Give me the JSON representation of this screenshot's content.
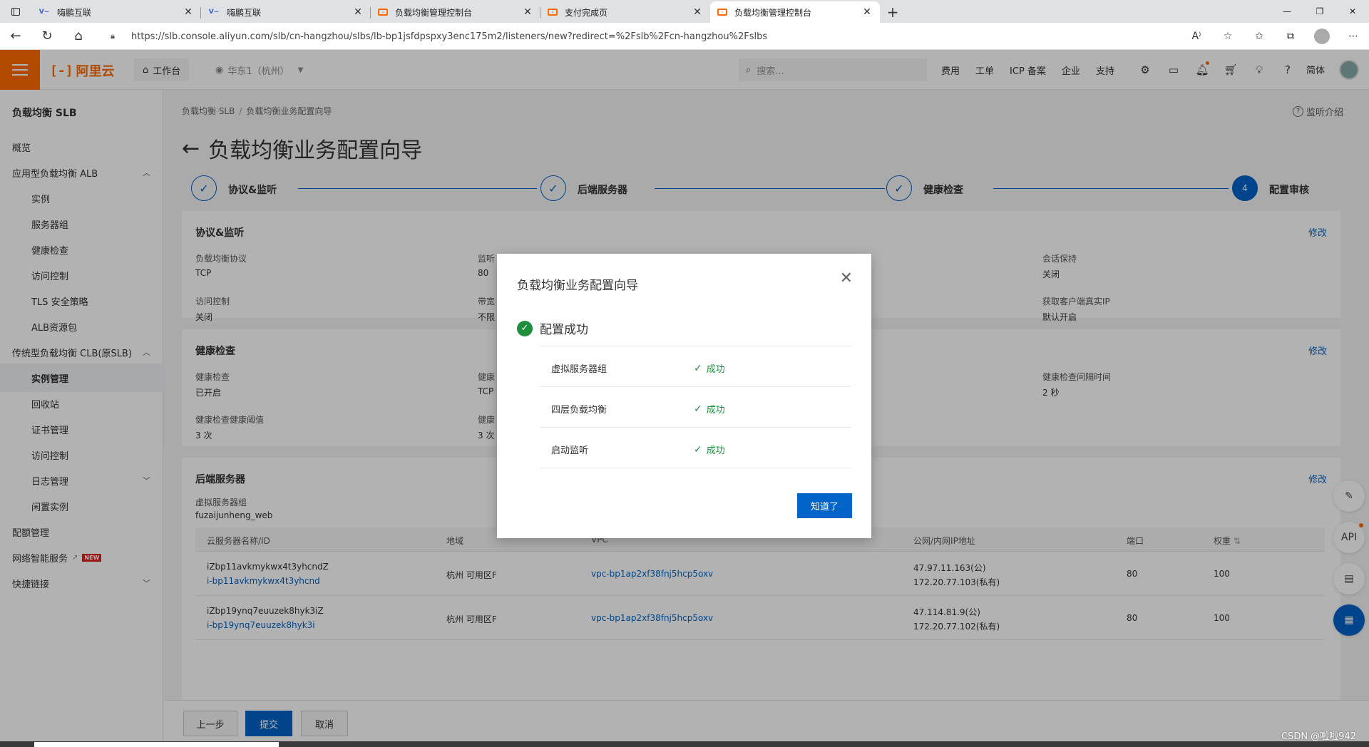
{
  "browser": {
    "tabs": [
      {
        "title": "嗨鹏互联",
        "favicon": "blue"
      },
      {
        "title": "嗨鹏互联",
        "favicon": "blue"
      },
      {
        "title": "负载均衡管理控制台",
        "favicon": "orange"
      },
      {
        "title": "支付完成页",
        "favicon": "orange"
      },
      {
        "title": "负载均衡管理控制台",
        "favicon": "orange",
        "active": true
      }
    ],
    "url": "https://slb.console.aliyun.com/slb/cn-hangzhou/slbs/lb-bp1jsfdpspxy3enc175m2/listeners/new?redirect=%2Fslb%2Fcn-hangzhou%2Fslbs",
    "read_aloud": "A⁾"
  },
  "console": {
    "logo_text": "阿里云",
    "workbench": "工作台",
    "region": "华东1（杭州）",
    "search_placeholder": "搜索...",
    "links": [
      "费用",
      "工单",
      "ICP 备案",
      "企业",
      "支持"
    ],
    "lang": "简体"
  },
  "sidebar": {
    "title": "负载均衡 SLB",
    "items": [
      {
        "label": "概览",
        "level": 1
      },
      {
        "label": "应用型负载均衡 ALB",
        "level": 1,
        "chev": "up"
      },
      {
        "label": "实例",
        "level": 2
      },
      {
        "label": "服务器组",
        "level": 2
      },
      {
        "label": "健康检查",
        "level": 2
      },
      {
        "label": "访问控制",
        "level": 2
      },
      {
        "label": "TLS 安全策略",
        "level": 2
      },
      {
        "label": "ALB资源包",
        "level": 2
      },
      {
        "label": "传统型负载均衡 CLB(原SLB)",
        "level": 1,
        "chev": "up"
      },
      {
        "label": "实例管理",
        "level": 2,
        "active": true
      },
      {
        "label": "回收站",
        "level": 2
      },
      {
        "label": "证书管理",
        "level": 2
      },
      {
        "label": "访问控制",
        "level": 2
      },
      {
        "label": "日志管理",
        "level": 2,
        "chev": "down"
      },
      {
        "label": "闲置实例",
        "level": 2
      },
      {
        "label": "配额管理",
        "level": 1
      },
      {
        "label": "网络智能服务",
        "level": 1,
        "new": "NEW"
      },
      {
        "label": "快捷链接",
        "level": 1,
        "chev": "down"
      }
    ]
  },
  "main": {
    "breadcrumb": [
      "负载均衡 SLB",
      "负载均衡业务配置向导"
    ],
    "help_link": "监听介绍",
    "title": "负载均衡业务配置向导",
    "steps": [
      {
        "label": "协议&监听",
        "state": "done"
      },
      {
        "label": "后端服务器",
        "state": "done"
      },
      {
        "label": "健康检查",
        "state": "done"
      },
      {
        "label": "配置审核",
        "state": "current",
        "number": "4"
      }
    ],
    "edit_label": "修改",
    "protocol_card": {
      "title": "协议&监听",
      "fields": [
        {
          "label": "负载均衡协议",
          "value": "TCP"
        },
        {
          "label": "监听",
          "value": "80"
        },
        {
          "label": "会话保持",
          "value": "关闭"
        },
        {
          "label": "访问控制",
          "value": "关闭"
        },
        {
          "label": "带宽",
          "value": "不限"
        },
        {
          "label": "获取客户端真实IP",
          "value": "默认开启"
        }
      ]
    },
    "health_card": {
      "title": "健康检查",
      "fields": [
        {
          "label": "健康检查",
          "value": "已开启"
        },
        {
          "label": "健康",
          "value": "TCP"
        },
        {
          "label": "健康检查间隔时间",
          "value": "2 秒"
        },
        {
          "label": "健康检查健康阈值",
          "value": "3 次"
        },
        {
          "label": "健康",
          "value": "3 次"
        }
      ]
    },
    "backend_card": {
      "title": "后端服务器",
      "group_label": "虚拟服务器组",
      "group_value": "fuzaijunheng_web",
      "columns": [
        "云服务器名称/ID",
        "地域",
        "VPC",
        "公网/内网IP地址",
        "端口",
        "权重"
      ],
      "rows": [
        {
          "name": "iZbp11avkmykwx4t3yhcndZ",
          "id": "i-bp11avkmykwx4t3yhcnd",
          "region": "杭州 可用区F",
          "vpc": "vpc-bp1ap2xf38fnj5hcp5oxv",
          "public_ip": "47.97.11.163(公)",
          "private_ip": "172.20.77.103(私有)",
          "port": "80",
          "weight": "100"
        },
        {
          "name": "iZbp19ynq7euuzek8hyk3iZ",
          "id": "i-bp19ynq7euuzek8hyk3i",
          "region": "杭州 可用区F",
          "vpc": "vpc-bp1ap2xf38fnj5hcp5oxv",
          "public_ip": "47.114.81.9(公)",
          "private_ip": "172.20.77.102(私有)",
          "port": "80",
          "weight": "100"
        }
      ]
    },
    "footer": {
      "prev": "上一步",
      "submit": "提交",
      "cancel": "取消"
    }
  },
  "modal": {
    "title": "负载均衡业务配置向导",
    "status": "配置成功",
    "results": [
      {
        "name": "虚拟服务器组",
        "status": "成功"
      },
      {
        "name": "四层负载均衡",
        "status": "成功"
      },
      {
        "name": "启动监听",
        "status": "成功"
      }
    ],
    "ok_button": "知道了"
  },
  "watermark": "CSDN @啦啦942",
  "colors": {
    "brand": "#ff6a00",
    "primary": "#0064c8",
    "success": "#1e8e3e"
  }
}
